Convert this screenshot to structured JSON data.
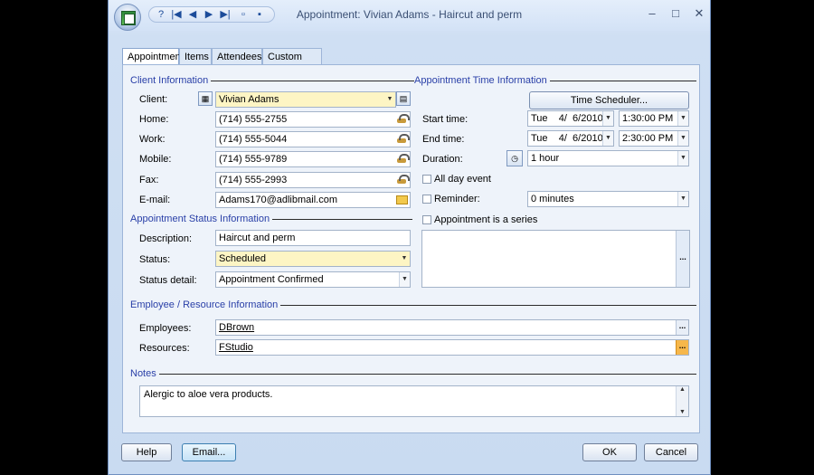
{
  "window": {
    "title": "Appointment: Vivian Adams - Haircut and perm",
    "qat_icons": [
      "help-icon",
      "first-record-icon",
      "previous-record-icon",
      "next-record-icon",
      "last-record-icon",
      "new-record-icon",
      "save-icon"
    ],
    "qat_glyphs": [
      "?",
      "|◀",
      "◀",
      "▶",
      "▶|",
      "▫",
      "▪"
    ],
    "controls": {
      "minimize": "–",
      "maximize": "□",
      "close": "✕"
    }
  },
  "tabs": [
    {
      "label": "Appointment",
      "active": true
    },
    {
      "label": "Items"
    },
    {
      "label": "Attendees"
    },
    {
      "label": "Custom Fields"
    }
  ],
  "client": {
    "section_title": "Client Information",
    "client_label": "Client:",
    "client_value": "Vivian Adams",
    "home_label": "Home:",
    "home_value": "(714) 555-2755",
    "work_label": "Work:",
    "work_value": "(714) 555-5044",
    "mobile_label": "Mobile:",
    "mobile_value": "(714) 555-9789",
    "fax_label": "Fax:",
    "fax_value": "(714) 555-2993",
    "email_label": "E-mail:",
    "email_value": "Adams170@adlibmail.com"
  },
  "time": {
    "section_title": "Appointment Time Information",
    "scheduler_button": "Time Scheduler...",
    "start_label": "Start time:",
    "start_date": "Tue    4/  6/2010",
    "start_time": "1:30:00 PM",
    "end_label": "End time:",
    "end_date": "Tue    4/  6/2010",
    "end_time": "2:30:00 PM",
    "duration_label": "Duration:",
    "duration_value": "1 hour",
    "all_day_label": "All day event",
    "reminder_label": "Reminder:",
    "reminder_value": "0 minutes",
    "series_label": "Appointment is a series"
  },
  "status": {
    "section_title": "Appointment Status Information",
    "description_label": "Description:",
    "description_value": "Haircut and perm",
    "status_label": "Status:",
    "status_value": "Scheduled",
    "detail_label": "Status detail:",
    "detail_value": "Appointment Confirmed"
  },
  "employee": {
    "section_title": "Employee / Resource Information",
    "employees_label": "Employees:",
    "employees_value": "DBrown",
    "resources_label": "Resources:",
    "resources_value": "FStudio"
  },
  "notes": {
    "section_title": "Notes",
    "value": "Alergic to aloe vera products."
  },
  "footer": {
    "help": "Help",
    "email": "Email...",
    "ok": "OK",
    "cancel": "Cancel"
  },
  "ellipsis": "...",
  "dropdown_arrow": "▼",
  "scroll_up": "▲",
  "scroll_down": "▼",
  "colors": {
    "section_heading": "#2a40a8",
    "required_field": "#fdf5c4",
    "resource_button": "#f6b74b"
  }
}
